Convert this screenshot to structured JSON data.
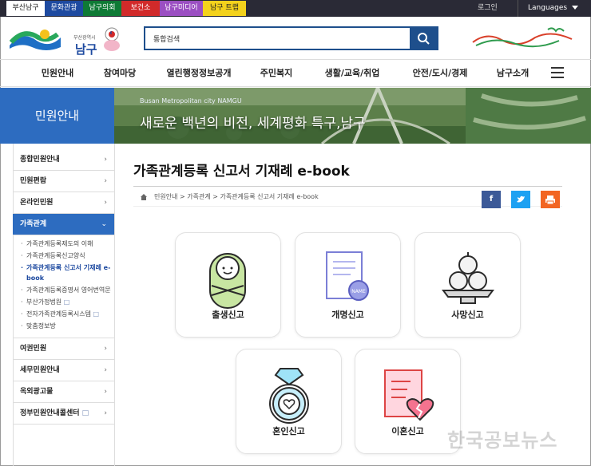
{
  "quick_links": [
    {
      "label": "부산남구",
      "bg": "#ffffff",
      "fg": "#222222"
    },
    {
      "label": "문화관광",
      "bg": "#1e4aa0",
      "fg": "#ffffff"
    },
    {
      "label": "남구의회",
      "bg": "#0e7a35",
      "fg": "#ffffff"
    },
    {
      "label": "보건소",
      "bg": "#d12a2a",
      "fg": "#ffffff"
    },
    {
      "label": "남구미디어",
      "bg": "#9b4fc2",
      "fg": "#ffffff"
    },
    {
      "label": "남구 트랩",
      "bg": "#f4d21c",
      "fg": "#222222"
    }
  ],
  "utility": {
    "login": "로그인",
    "language": "Languages"
  },
  "logo": {
    "sub": "부산광역시",
    "main": "남구"
  },
  "search": {
    "placeholder": "통합검색"
  },
  "gnb": [
    "민원안내",
    "참여마당",
    "열린행정정보공개",
    "주민복지",
    "생활/교육/취업",
    "안전/도시/경제",
    "남구소개"
  ],
  "banner": {
    "section_title": "민원안내",
    "english": "Busan Metropolitan city NAMGU",
    "slogan": "새로운 백년의 비전, 세계평화 특구,남구"
  },
  "lnb": {
    "items_top": [
      "종합민원안내",
      "민원편람",
      "온라인민원"
    ],
    "active": "가족관계",
    "sub_items": [
      "가족관계등록제도의 이해",
      "가족관계등록신고양식",
      "가족관계등록 신고서 기재례 e-book",
      "가족관계등록증명서 영어번역문",
      "부산가정법원",
      "전자가족관계등록시스템",
      "맞춤정보방"
    ],
    "items_bottom": [
      "여권민원",
      "세무민원안내",
      "옥외광고물",
      "정부민원안내콜센터"
    ]
  },
  "page": {
    "title": "가족관계등록 신고서 기재례 e-book",
    "breadcrumb": "민원안내 > 가족관계 > 가족관계등록 신고서 기재례 e-book",
    "share": {
      "facebook": "f",
      "twitter": "t",
      "print": "p"
    }
  },
  "cards": [
    "출생신고",
    "개명신고",
    "사망신고",
    "혼인신고",
    "이혼신고"
  ],
  "watermark": "한국공보뉴스",
  "colors": {
    "primary": "#2d6cc0",
    "search": "#1e4f8c",
    "facebook": "#3b5998",
    "twitter": "#1da1f2",
    "print": "#f26522"
  }
}
